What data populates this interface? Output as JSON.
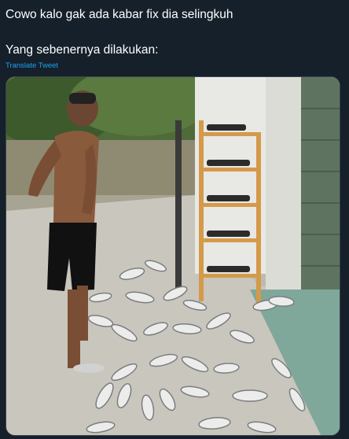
{
  "tweet": {
    "line1": "Cowo kalo gak ada kabar fix dia selingkuh",
    "line2": "Yang sebenernya dilakukan:",
    "translate_label": "Translate Tweet"
  },
  "media": {
    "icon": "photo-icon"
  },
  "colors": {
    "background": "#15202b",
    "text": "#ffffff",
    "link": "#1da1f2"
  }
}
